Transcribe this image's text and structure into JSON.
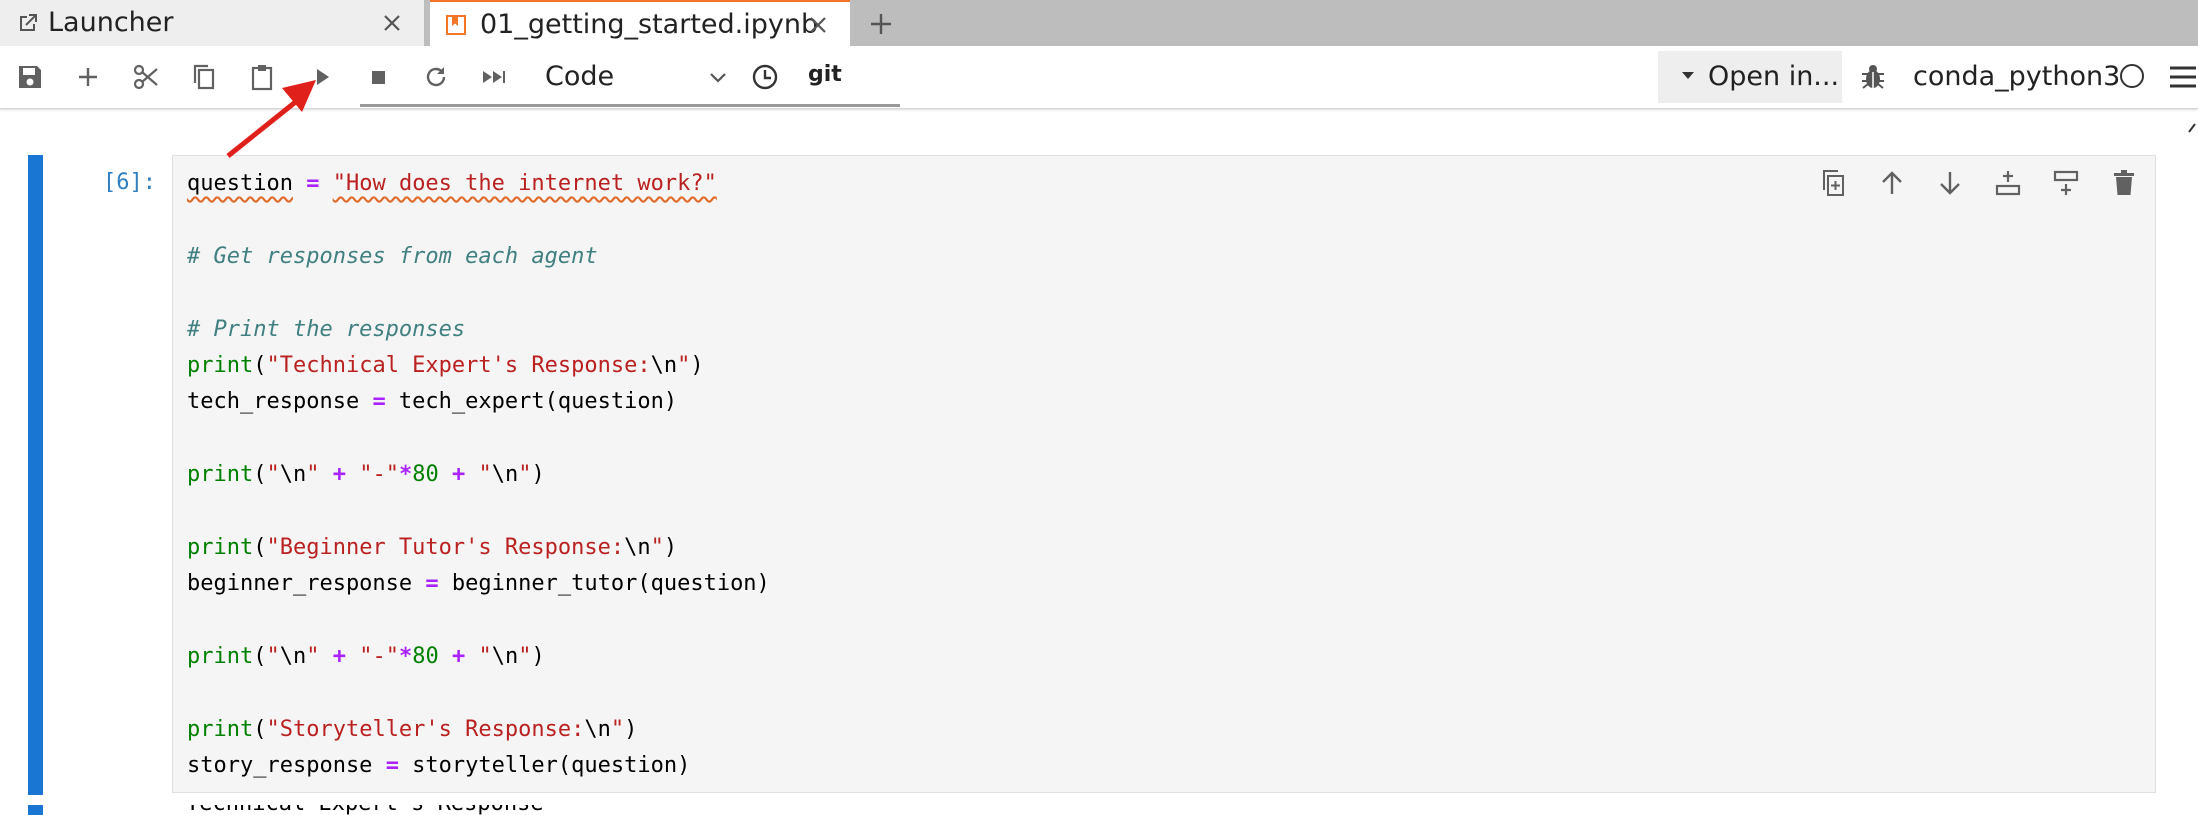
{
  "tabs": [
    {
      "label": "Launcher",
      "active": false
    },
    {
      "label": "01_getting_started.ipynb",
      "active": true
    }
  ],
  "toolbar": {
    "cell_type": "Code",
    "git_label": "git",
    "open_in_label": "Open in...",
    "kernel_name": "conda_python3"
  },
  "cell": {
    "prompt": "[6]:",
    "code_lines": [
      [
        {
          "t": "question",
          "c": "sq"
        },
        {
          "t": " ",
          "c": ""
        },
        {
          "t": "=",
          "c": "op"
        },
        {
          "t": " ",
          "c": ""
        },
        {
          "t": "\"How does the internet work?\"",
          "c": "str sq"
        }
      ],
      [],
      [
        {
          "t": "# Get responses from each agent",
          "c": "cmt"
        }
      ],
      [],
      [
        {
          "t": "# Print the responses",
          "c": "cmt"
        }
      ],
      [
        {
          "t": "print",
          "c": "kw"
        },
        {
          "t": "(",
          "c": ""
        },
        {
          "t": "\"Technical Expert's Response:",
          "c": "str"
        },
        {
          "t": "\\n",
          "c": ""
        },
        {
          "t": "\"",
          "c": "str"
        },
        {
          "t": ")",
          "c": ""
        }
      ],
      [
        {
          "t": "tech_response ",
          "c": ""
        },
        {
          "t": "=",
          "c": "op"
        },
        {
          "t": " tech_expert(question)",
          "c": ""
        }
      ],
      [],
      [
        {
          "t": "print",
          "c": "kw"
        },
        {
          "t": "(",
          "c": ""
        },
        {
          "t": "\"",
          "c": "str"
        },
        {
          "t": "\\n",
          "c": ""
        },
        {
          "t": "\"",
          "c": "str"
        },
        {
          "t": " ",
          "c": ""
        },
        {
          "t": "+",
          "c": "op"
        },
        {
          "t": " ",
          "c": ""
        },
        {
          "t": "\"-\"",
          "c": "str"
        },
        {
          "t": "*",
          "c": "op"
        },
        {
          "t": "80",
          "c": "kw"
        },
        {
          "t": " ",
          "c": ""
        },
        {
          "t": "+",
          "c": "op"
        },
        {
          "t": " ",
          "c": ""
        },
        {
          "t": "\"",
          "c": "str"
        },
        {
          "t": "\\n",
          "c": ""
        },
        {
          "t": "\"",
          "c": "str"
        },
        {
          "t": ")",
          "c": ""
        }
      ],
      [],
      [
        {
          "t": "print",
          "c": "kw"
        },
        {
          "t": "(",
          "c": ""
        },
        {
          "t": "\"Beginner Tutor's Response:",
          "c": "str"
        },
        {
          "t": "\\n",
          "c": ""
        },
        {
          "t": "\"",
          "c": "str"
        },
        {
          "t": ")",
          "c": ""
        }
      ],
      [
        {
          "t": "beginner_response ",
          "c": ""
        },
        {
          "t": "=",
          "c": "op"
        },
        {
          "t": " beginner_tutor(question)",
          "c": ""
        }
      ],
      [],
      [
        {
          "t": "print",
          "c": "kw"
        },
        {
          "t": "(",
          "c": ""
        },
        {
          "t": "\"",
          "c": "str"
        },
        {
          "t": "\\n",
          "c": ""
        },
        {
          "t": "\"",
          "c": "str"
        },
        {
          "t": " ",
          "c": ""
        },
        {
          "t": "+",
          "c": "op"
        },
        {
          "t": " ",
          "c": ""
        },
        {
          "t": "\"-\"",
          "c": "str"
        },
        {
          "t": "*",
          "c": "op"
        },
        {
          "t": "80",
          "c": "kw"
        },
        {
          "t": " ",
          "c": ""
        },
        {
          "t": "+",
          "c": "op"
        },
        {
          "t": " ",
          "c": ""
        },
        {
          "t": "\"",
          "c": "str"
        },
        {
          "t": "\\n",
          "c": ""
        },
        {
          "t": "\"",
          "c": "str"
        },
        {
          "t": ")",
          "c": ""
        }
      ],
      [],
      [
        {
          "t": "print",
          "c": "kw"
        },
        {
          "t": "(",
          "c": ""
        },
        {
          "t": "\"Storyteller's Response:",
          "c": "str"
        },
        {
          "t": "\\n",
          "c": ""
        },
        {
          "t": "\"",
          "c": "str"
        },
        {
          "t": ")",
          "c": ""
        }
      ],
      [
        {
          "t": "story_response ",
          "c": ""
        },
        {
          "t": "=",
          "c": "op"
        },
        {
          "t": " storyteller(question)",
          "c": ""
        }
      ]
    ],
    "output_peek": "Technical Expert's Response"
  },
  "icons": {
    "launcher_tab": "external-link-icon",
    "notebook_tab": "notebook-icon",
    "save": "save-icon",
    "insert": "plus-icon",
    "cut": "scissors-icon",
    "copy": "copy-icon",
    "paste": "paste-icon",
    "run": "play-icon",
    "interrupt": "stop-icon",
    "restart": "restart-icon",
    "run_all": "fast-forward-icon",
    "history": "clock-icon",
    "debugger": "bug-icon"
  },
  "colors": {
    "cell_marker": "#1976d2",
    "prompt": "#307fc1",
    "annotation": "#e0201b"
  }
}
